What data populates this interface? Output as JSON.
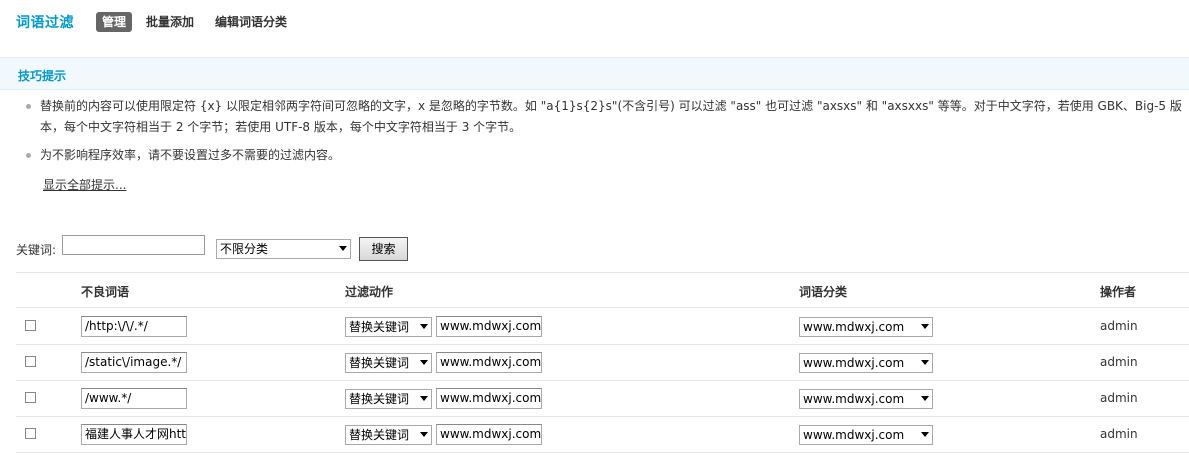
{
  "header": {
    "title": "词语过滤",
    "tabs": [
      {
        "label": "管理",
        "active": true
      },
      {
        "label": "批量添加",
        "active": false
      },
      {
        "label": "编辑词语分类",
        "active": false
      }
    ]
  },
  "tips": {
    "heading": "技巧提示",
    "items": [
      "替换前的内容可以使用限定符 {x} 以限定相邻两字符间可忽略的文字，x 是忽略的字节数。如 \"a{1}s{2}s\"(不含引号) 可以过滤 \"ass\" 也可过滤 \"axsxs\" 和 \"axsxxs\" 等等。对于中文字符，若使用 GBK、Big-5 版本，每个中文字符相当于 2 个字节；若使用 UTF-8 版本，每个中文字符相当于 3 个字节。",
      "为不影响程序效率，请不要设置过多不需要的过滤内容。"
    ],
    "show_all": "显示全部提示..."
  },
  "search": {
    "keyword_label": "关键词:",
    "keyword_value": "",
    "category_selected": "不限分类",
    "button_label": "搜索"
  },
  "table": {
    "headers": {
      "word": "不良词语",
      "action": "过滤动作",
      "category": "词语分类",
      "operator": "操作者"
    },
    "rows": [
      {
        "word": "/http:\\/\\/.*/",
        "action": "替换关键词",
        "replacement": "www.mdwxj.com",
        "category": "www.mdwxj.com",
        "operator": "admin"
      },
      {
        "word": "/static\\/image.*/",
        "action": "替换关键词",
        "replacement": "www.mdwxj.com",
        "category": "www.mdwxj.com",
        "operator": "admin"
      },
      {
        "word": "/www.*/",
        "action": "替换关键词",
        "replacement": "www.mdwxj.com",
        "category": "www.mdwxj.com",
        "operator": "admin"
      },
      {
        "word": "福建人事人才网http",
        "action": "替换关键词",
        "replacement": "www.mdwxj.com",
        "category": "www.mdwxj.com",
        "operator": "admin"
      }
    ]
  },
  "colors": {
    "accent": "#0099cc",
    "tips_background": "#f2f9fd",
    "active_tab": "#666666"
  }
}
